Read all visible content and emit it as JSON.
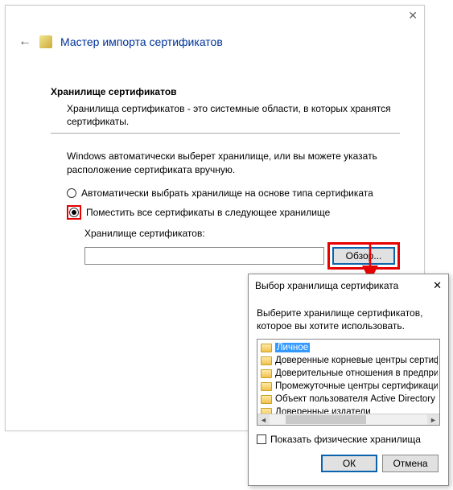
{
  "main": {
    "title": "Мастер импорта сертификатов",
    "section_title": "Хранилище сертификатов",
    "section_desc": "Хранилища сертификатов - это системные области, в которых хранятся сертификаты.",
    "auto_text": "Windows автоматически выберет хранилище, или вы можете указать расположение сертификата вручную.",
    "radio_auto": "Автоматически выбрать хранилище на основе типа сертификата",
    "radio_place": "Поместить все сертификаты в следующее хранилище",
    "store_label": "Хранилище сертификатов:",
    "browse": "Обзор..."
  },
  "dialog": {
    "title": "Выбор хранилища сертификата",
    "instr": "Выберите хранилище сертификатов, которое вы хотите использовать.",
    "items": [
      "Личное",
      "Доверенные корневые центры сертифика",
      "Доверительные отношения в предприяти",
      "Промежуточные центры сертификации",
      "Объект пользователя Active Directory",
      "Доверенные издатели"
    ],
    "show_physical": "Показать физические хранилища",
    "ok": "ОК",
    "cancel": "Отмена"
  }
}
